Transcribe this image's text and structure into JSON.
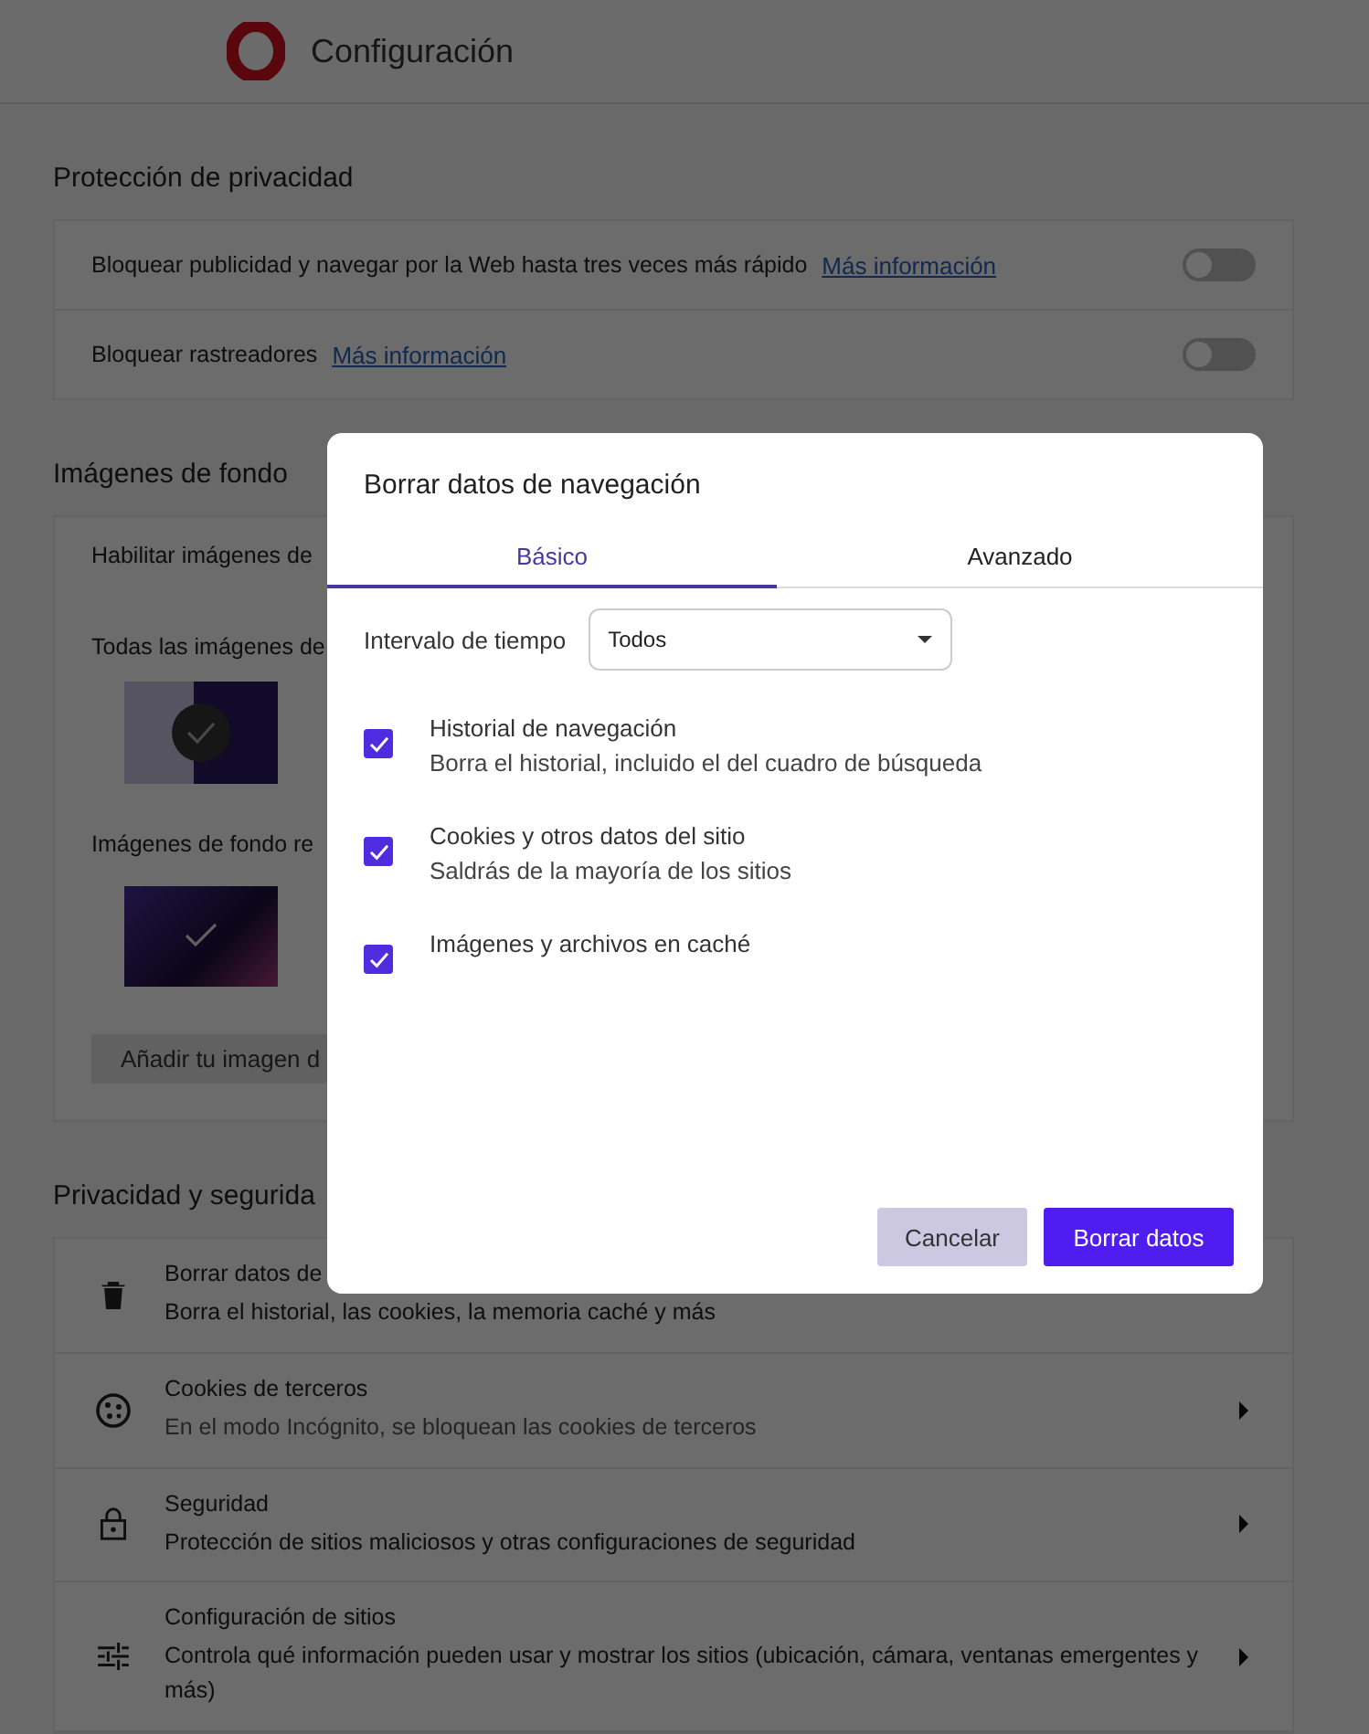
{
  "header": {
    "title": "Configuración"
  },
  "privacy_protection": {
    "title": "Protección de privacidad",
    "rows": [
      {
        "label": "Bloquear publicidad y navegar por la Web hasta tres veces más rápido",
        "link": "Más información",
        "on": false
      },
      {
        "label": "Bloquear rastreadores",
        "link": "Más información",
        "on": false
      }
    ]
  },
  "backgrounds": {
    "title": "Imágenes de fondo",
    "enable_label": "Habilitar imágenes de",
    "all_label": "Todas las imágenes de",
    "recent_label": "Imágenes de fondo re",
    "add_button": "Añadir tu imagen d"
  },
  "privacy_security": {
    "title": "Privacidad y segurida",
    "rows": [
      {
        "kind": "trash",
        "title": "Borrar datos de",
        "subtitle": "Borra el historial, las cookies, la memoria caché y más"
      },
      {
        "kind": "cookie",
        "title": "Cookies de terceros",
        "subtitle": "En el modo Incógnito, se bloquean las cookies de terceros"
      },
      {
        "kind": "lock",
        "title": "Seguridad",
        "subtitle": "Protección de sitios maliciosos y otras configuraciones de seguridad"
      },
      {
        "kind": "sliders",
        "title": "Configuración de sitios",
        "subtitle": "Controla qué información pueden usar y mostrar los sitios (ubicación, cámara, ventanas emergentes y más)"
      }
    ]
  },
  "dialog": {
    "title": "Borrar datos de navegación",
    "tabs": [
      {
        "label": "Básico",
        "selected": true
      },
      {
        "label": "Avanzado",
        "selected": false
      }
    ],
    "time_range": {
      "label": "Intervalo de tiempo",
      "value": "Todos"
    },
    "options": [
      {
        "label": "Historial de navegación",
        "description": "Borra el historial, incluido el del cuadro de búsqueda",
        "checked": true
      },
      {
        "label": "Cookies y otros datos del sitio",
        "description": "Saldrás de la mayoría de los sitios",
        "checked": true
      },
      {
        "label": "Imágenes y archivos en caché",
        "checked": true
      }
    ],
    "buttons": {
      "cancel": "Cancelar",
      "confirm": "Borrar datos"
    }
  }
}
